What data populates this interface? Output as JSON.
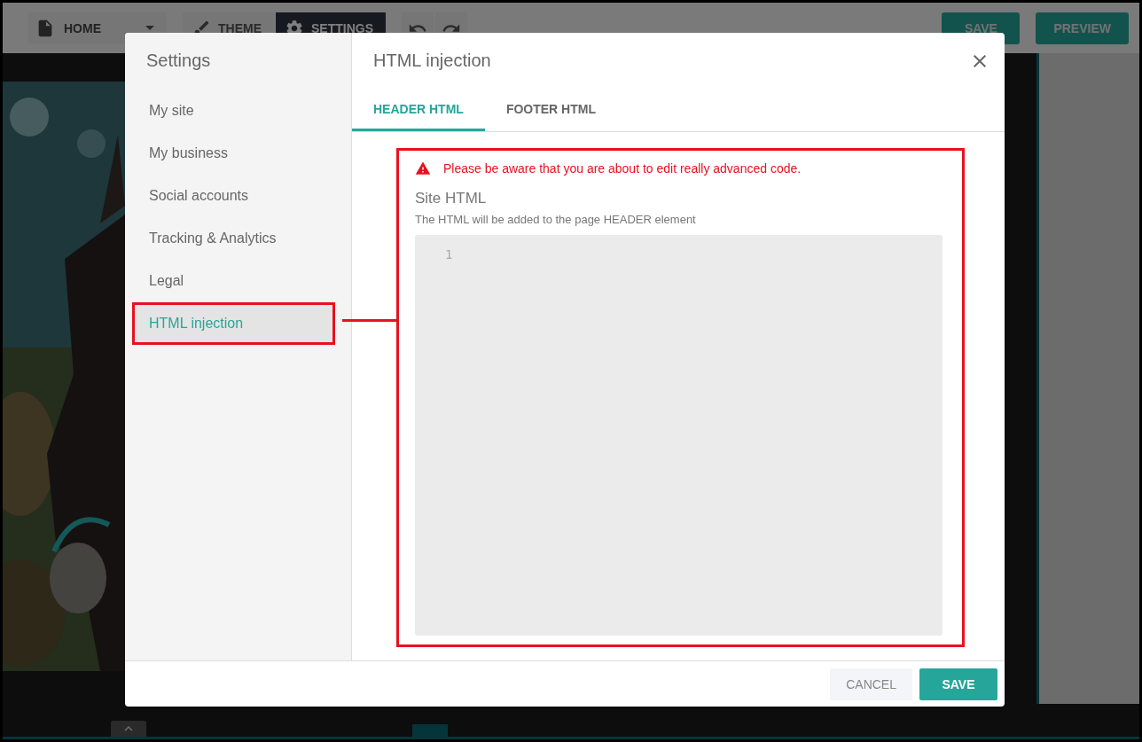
{
  "toolbar": {
    "page_select": {
      "label": "HOME"
    },
    "modes": [
      {
        "label": "THEME",
        "selected": false
      },
      {
        "label": "SETTINGS",
        "selected": true
      }
    ],
    "actions": [
      "SAVE",
      "PREVIEW"
    ]
  },
  "dialog": {
    "sidebar": {
      "title": "Settings",
      "items": [
        {
          "label": "My site",
          "selected": false
        },
        {
          "label": "My business",
          "selected": false
        },
        {
          "label": "Social accounts",
          "selected": false
        },
        {
          "label": "Tracking & Analytics",
          "selected": false
        },
        {
          "label": "Legal",
          "selected": false
        },
        {
          "label": "HTML injection",
          "selected": true
        }
      ]
    },
    "title": "HTML injection",
    "tabs": [
      {
        "label": "HEADER HTML",
        "selected": true
      },
      {
        "label": "FOOTER HTML",
        "selected": false
      }
    ],
    "warning": "Please be aware that you are about to edit really advanced code.",
    "field": {
      "label": "Site HTML",
      "hint": "The HTML will be added to the page HEADER element",
      "line_numbers": [
        "1"
      ]
    },
    "buttons": [
      {
        "label": "CANCEL",
        "kind": "secondary"
      },
      {
        "label": "SAVE",
        "kind": "primary"
      }
    ]
  }
}
